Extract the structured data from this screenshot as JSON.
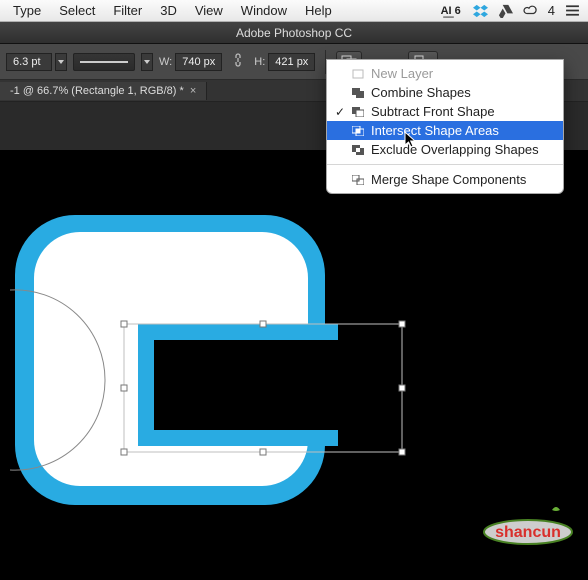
{
  "menubar": {
    "items": [
      "Type",
      "Select",
      "Filter",
      "3D",
      "View",
      "Window",
      "Help"
    ],
    "ai_label": "A͟I 6",
    "four_label": "4"
  },
  "titlebar": {
    "title": "Adobe Photoshop CC"
  },
  "optionsbar": {
    "stroke_pt": "6.3 pt",
    "w_label": "W:",
    "w_value": "740 px",
    "h_label": "H:",
    "h_value": "421 px"
  },
  "tabstrip": {
    "doc_title": "-1 @ 66.7% (Rectangle 1, RGB/8) *",
    "close_glyph": "×"
  },
  "dropdown": {
    "items": [
      {
        "label": "New Layer",
        "disabled": true,
        "checked": false
      },
      {
        "label": "Combine Shapes",
        "disabled": false,
        "checked": false
      },
      {
        "label": "Subtract Front Shape",
        "disabled": false,
        "checked": true
      },
      {
        "label": "Intersect Shape Areas",
        "disabled": false,
        "checked": false,
        "selected": true
      },
      {
        "label": "Exclude Overlapping Shapes",
        "disabled": false,
        "checked": false
      }
    ],
    "merge_label": "Merge Shape Components"
  },
  "watermark": {
    "text": "shancun"
  },
  "colors": {
    "shape_blue": "#29abe2",
    "menu_highlight": "#2a6fe0"
  }
}
